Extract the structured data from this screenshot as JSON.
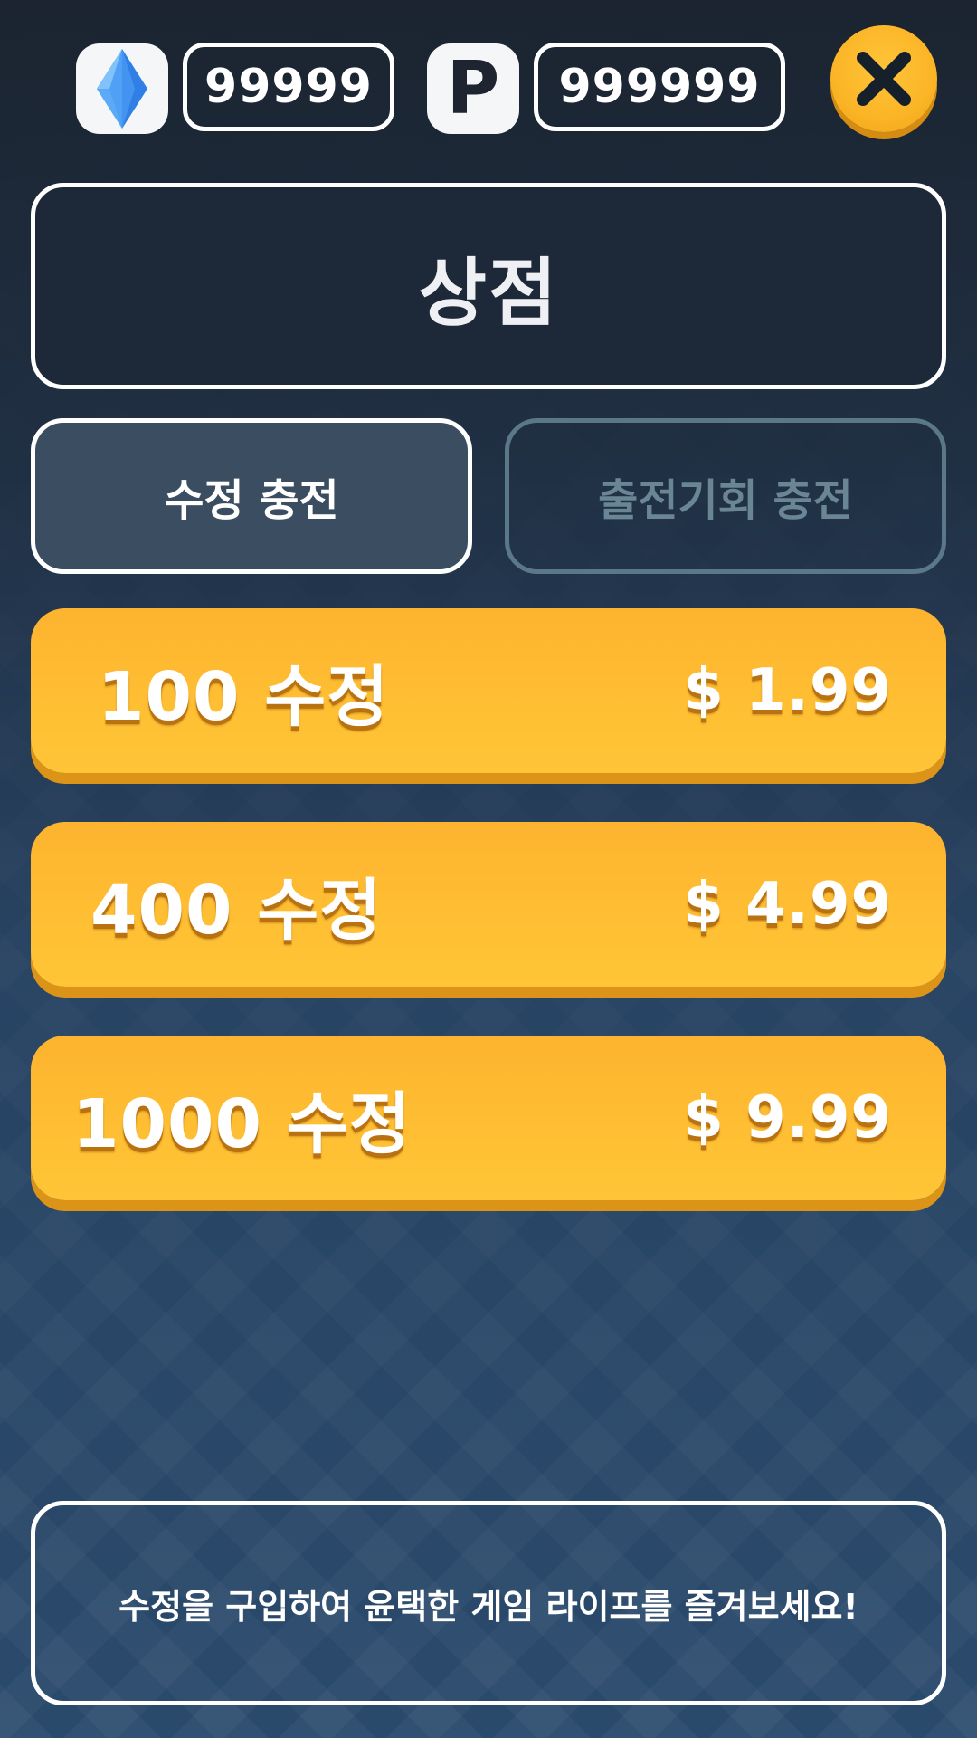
{
  "currency": {
    "gem_icon": "crystal-gem-icon",
    "gem_amount": "99999",
    "point_icon_letter": "P",
    "point_amount": "999999"
  },
  "header": {
    "close_icon": "close-x-icon",
    "title": "상점"
  },
  "tabs": [
    {
      "label": "수정 충전",
      "active": true
    },
    {
      "label": "출전기회 충전",
      "active": false
    }
  ],
  "products": [
    {
      "name": "100 수정",
      "price": "$ 1.99"
    },
    {
      "name": "400 수정",
      "price": "$ 4.99"
    },
    {
      "name": "1000 수정",
      "price": "$ 9.99"
    }
  ],
  "footer": {
    "message": "수정을 구입하여 윤택한 게임 라이프를 즐겨보세요!"
  },
  "colors": {
    "accent": "#ffbf33",
    "accent_shadow": "#dc9418",
    "panel_dark": "#1d2838",
    "tab_active_bg": "#3b4d61",
    "tab_inactive_text": "#6a8594",
    "gem_blue": "#3b8df0"
  }
}
